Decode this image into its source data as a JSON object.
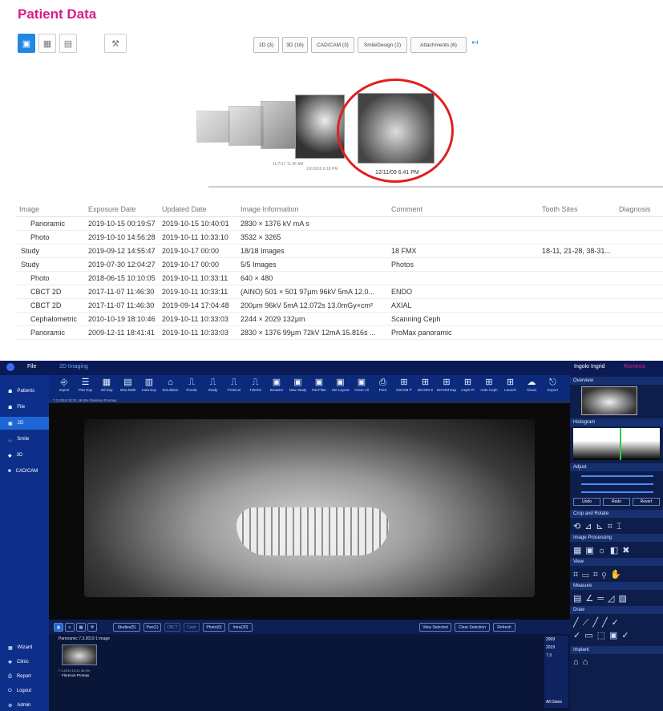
{
  "header": {
    "title": "Patient Data"
  },
  "filters": [
    "2D (3)",
    "3D (16)",
    "CAD/CAM (3)",
    "SmileDesign (2)",
    "Attachments (6)"
  ],
  "timeline": {
    "labels": [
      "12/11/09 6:41 PM",
      "10/19/10 6:18 PM",
      "11/7/17 11:46 AM"
    ]
  },
  "table": {
    "headers": [
      "Image",
      "Exposure Date",
      "Updated Date",
      "Image Information",
      "Comment",
      "Tooth Sites",
      "Diagnosis"
    ],
    "rows": [
      {
        "type": "Panoramic",
        "exposure": "2019-10-15 00:19:57",
        "updated": "2019-10-15 10:40:01",
        "info": "2830 × 1376 kV mA s",
        "comment": "",
        "teeth": ""
      },
      {
        "type": "Photo",
        "exposure": "2019-10-10 14:56:28",
        "updated": "2019-10-11 10:33:10",
        "info": "3532 × 3265",
        "comment": "",
        "teeth": ""
      },
      {
        "type": "Study",
        "exposure": "2019-09-12 14:55:47",
        "updated": "2019-10-17 00:00",
        "info": "18/18 Images",
        "comment": "18 FMX",
        "teeth": "18-11, 21-28, 38-31..."
      },
      {
        "type": "Study",
        "exposure": "2019-07-30 12:04:27",
        "updated": "2019-10-17 00:00",
        "info": "5/5 Images",
        "comment": "Photos",
        "teeth": ""
      },
      {
        "type": "Photo",
        "exposure": "2018-06-15 10:10:05",
        "updated": "2019-10-11 10:33:11",
        "info": "640 × 480",
        "comment": "",
        "teeth": ""
      },
      {
        "type": "CBCT 2D",
        "exposure": "2017-11-07 11:46:30",
        "updated": "2019-10-11 10:33:11",
        "info": "(AINO) 501 × 501 97μm 96kV 5mA 12.0...",
        "comment": "ENDO",
        "teeth": ""
      },
      {
        "type": "CBCT 2D",
        "exposure": "2017-11-07 11:46:30",
        "updated": "2019-09-14 17:04:48",
        "info": "200μm 96kV 5mA 12.072s 13.0mGy×cm²",
        "comment": "AXIAL",
        "teeth": ""
      },
      {
        "type": "Cephalometric",
        "exposure": "2010-10-19 18:10:46",
        "updated": "2019-10-11 10:33:03",
        "info": "2244 × 2029 132μm",
        "comment": "Scanning Ceph",
        "teeth": ""
      },
      {
        "type": "Panoramic",
        "exposure": "2009-12-11 18:41:41",
        "updated": "2019-10-11 10:33:03",
        "info": "2830 × 1376 99μm 72kV 12mA 15.816s ...",
        "comment": "ProMax panoramic",
        "teeth": ""
      }
    ]
  },
  "app": {
    "menu": "File",
    "module": "2D Imaging",
    "user": "Ingolo Ingrid",
    "brand": "Romexis",
    "sidebar": [
      "Patients",
      "File",
      "2D",
      "Smile",
      "3D",
      "CAD/CAM"
    ],
    "sidebar_bottom": [
      "Wizard",
      "Clinic",
      "Report",
      "Logout",
      "Admin"
    ],
    "toolbar": [
      "Import",
      "Pan Exp",
      "Intl Exp",
      "Intra Multi",
      "Intra Exp",
      "Emulation",
      "Pronta",
      "Study",
      "Protocol",
      "TWAIN",
      "Browser",
      "New Study",
      "Pat Filter",
      "Set Layout",
      "Close All",
      "Print",
      "DICOM P",
      "DICOM S",
      "DICOM Exp",
      "Ceph Pt",
      "Auto Ceph",
      "Launch",
      "Cloud",
      "Export"
    ],
    "viewer_info": "Panoramic  7.3.2019  1 image",
    "viewer_title": "7.3.2019 10:21  46.5%  Florence Promax",
    "right_sections": [
      "Overview",
      "Histogram",
      "Adjust",
      "Crop and Rotate",
      "Image Processing",
      "View",
      "Measure",
      "Draw",
      "Implant"
    ],
    "adjust_buttons": [
      "Undo",
      "Redo",
      "Revert"
    ],
    "bottom_buttons": [
      "Studies(5)",
      "Pan(1)",
      "CBCT",
      "Ceph",
      "Photo(0)",
      "Intra(20)"
    ],
    "action_buttons": [
      "View Selected",
      "Clear Selection",
      "Refresh"
    ],
    "thumb_label": "Florence Promax",
    "thumb_date": "7.3.2019 10:21 46.5%",
    "checks": [
      "2009",
      "2019",
      "7.3",
      "All Dates"
    ]
  }
}
